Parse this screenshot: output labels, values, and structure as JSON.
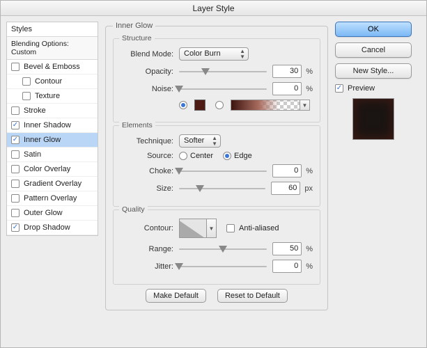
{
  "window": {
    "title": "Layer Style"
  },
  "sidebar": {
    "head": "Styles",
    "sub": "Blending Options: Custom",
    "items": [
      {
        "label": "Bevel & Emboss",
        "checked": false,
        "indent": false
      },
      {
        "label": "Contour",
        "checked": false,
        "indent": true
      },
      {
        "label": "Texture",
        "checked": false,
        "indent": true
      },
      {
        "label": "Stroke",
        "checked": false,
        "indent": false
      },
      {
        "label": "Inner Shadow",
        "checked": true,
        "indent": false
      },
      {
        "label": "Inner Glow",
        "checked": true,
        "indent": false,
        "selected": true
      },
      {
        "label": "Satin",
        "checked": false,
        "indent": false
      },
      {
        "label": "Color Overlay",
        "checked": false,
        "indent": false
      },
      {
        "label": "Gradient Overlay",
        "checked": false,
        "indent": false
      },
      {
        "label": "Pattern Overlay",
        "checked": false,
        "indent": false
      },
      {
        "label": "Outer Glow",
        "checked": false,
        "indent": false
      },
      {
        "label": "Drop Shadow",
        "checked": true,
        "indent": false
      }
    ]
  },
  "panel": {
    "title": "Inner Glow",
    "structure": {
      "title": "Structure",
      "blend_mode_label": "Blend Mode:",
      "blend_mode": "Color Burn",
      "opacity_label": "Opacity:",
      "opacity": "30",
      "opacity_unit": "%",
      "noise_label": "Noise:",
      "noise": "0",
      "noise_unit": "%",
      "color_source": "color",
      "swatch_color": "#4d1a14"
    },
    "elements": {
      "title": "Elements",
      "technique_label": "Technique:",
      "technique": "Softer",
      "source_label": "Source:",
      "source_center": "Center",
      "source_edge": "Edge",
      "source": "edge",
      "choke_label": "Choke:",
      "choke": "0",
      "choke_unit": "%",
      "size_label": "Size:",
      "size": "60",
      "size_unit": "px"
    },
    "quality": {
      "title": "Quality",
      "contour_label": "Contour:",
      "antialias_label": "Anti-aliased",
      "antialias": false,
      "range_label": "Range:",
      "range": "50",
      "range_unit": "%",
      "jitter_label": "Jitter:",
      "jitter": "0",
      "jitter_unit": "%"
    },
    "buttons": {
      "make_default": "Make Default",
      "reset_default": "Reset to Default"
    }
  },
  "actions": {
    "ok": "OK",
    "cancel": "Cancel",
    "new_style": "New Style...",
    "preview_label": "Preview",
    "preview_checked": true
  }
}
